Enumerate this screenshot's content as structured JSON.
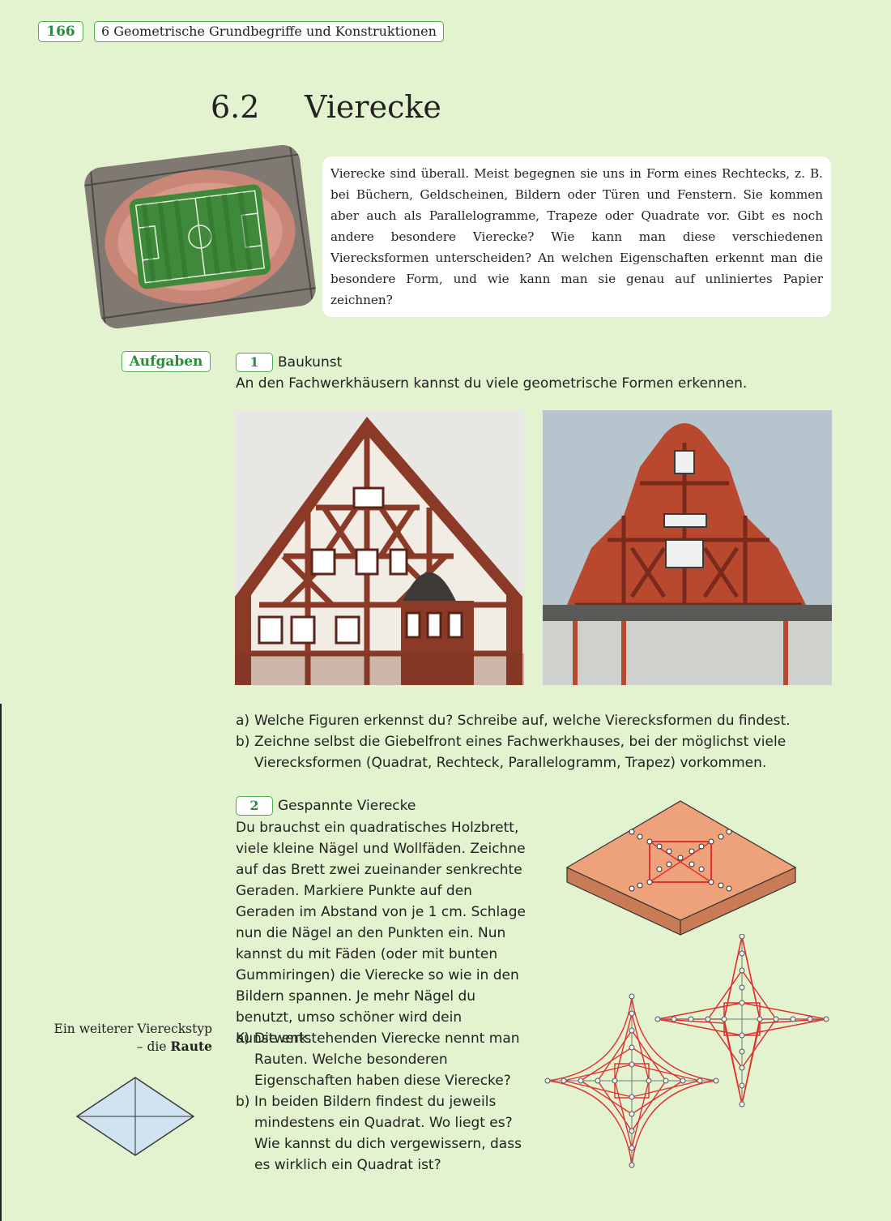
{
  "header": {
    "page_number": "166",
    "chapter": "6  Geometrische Grundbegriffe und Konstruktionen"
  },
  "section": {
    "number": "6.2",
    "title": "Vierecke"
  },
  "intro": {
    "text": "Vierecke sind überall. Meist begegnen sie uns in Form eines Rechtecks, z. B. bei Büchern, Geldscheinen, Bildern oder Türen und Fenstern. Sie kommen aber auch als Parallelogramme, Trapeze oder Quadrate vor. Gibt es noch andere besondere Vierecke? Wie kann man diese verschiedenen Vierecksformen unterscheiden? An welchen Eigenschaften erkennt man die besondere Form, und wie kann man sie genau auf unliniertes Papier zeichnen?"
  },
  "aufgaben_label": "Aufgaben",
  "task1": {
    "number": "1",
    "title": "Baukunst",
    "intro": "An den Fachwerkhäusern kannst du viele geometrische Formen erkennen.",
    "items": [
      {
        "label": "a)",
        "text": "Welche Figuren erkennst du? Schreibe auf, welche Vierecksformen du findest."
      },
      {
        "label": "b)",
        "text": "Zeichne selbst die Giebelfront eines Fachwerkhauses, bei der möglichst viele Vierecksformen (Quadrat, Rechteck, Parallelogramm, Trapez) vorkommen."
      }
    ]
  },
  "task2": {
    "number": "2",
    "title": "Gespannte Vierecke",
    "intro": "Du brauchst ein quadratisches Holzbrett, viele kleine Nägel und Wollfäden. Zeichne auf das Brett zwei zueinander senkrechte Geraden. Markiere Punkte auf den Geraden im Abstand von je 1 cm. Schlage nun die Nägel an den Punkten ein. Nun kannst du mit Fäden (oder mit bunten Gummiringen) die Vierecke so wie in den Bildern spannen. Je mehr Nägel du benutzt, umso schöner wird dein Kunstwerk.",
    "items": [
      {
        "label": "a)",
        "text": "Die entstehenden Vierecke nennt man Rauten. Welche besonderen Eigenschaften haben diese Vierecke?"
      },
      {
        "label": "b)",
        "text": "In beiden Bildern findest du jeweils mindestens ein Quadrat. Wo liegt es? Wie kannst du dich vergewissern, dass es wirklich ein Quadrat ist?"
      }
    ]
  },
  "side_note": {
    "line1": "Ein weiterer Viereckstyp",
    "line2_prefix": "– die ",
    "line2_bold": "Raute"
  },
  "colors": {
    "page_bg": "#e3f2cf",
    "accent_green": "#2e8b3d",
    "border_green": "#4fae4f",
    "thread_red": "#e03030",
    "board": "#eea27c"
  }
}
